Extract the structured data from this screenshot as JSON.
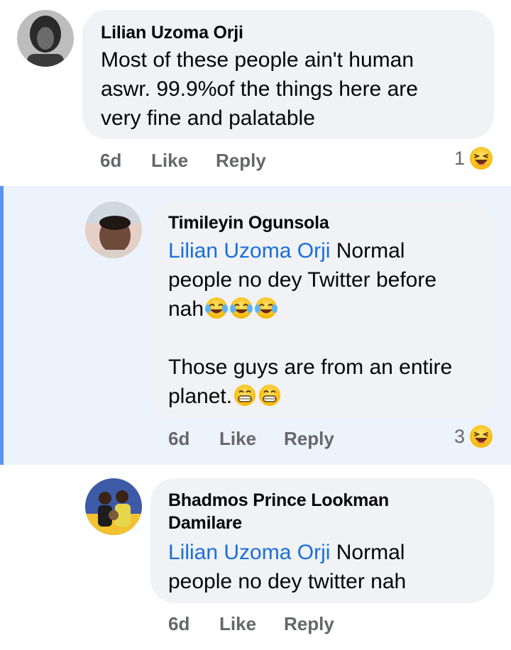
{
  "comments": [
    {
      "author": "Lilian Uzoma Orji",
      "lines": [
        "Most of these people ain't human",
        "aswr. 99.9%of the things here are",
        "very fine and palatable"
      ],
      "time": "6d",
      "like": "Like",
      "reply": "Reply",
      "reaction_count": "1",
      "reaction_icon": "haha-icon"
    },
    {
      "author": "Timileyin Ogunsola",
      "mention": "Lilian Uzoma Orji",
      "line1_rest": " Normal",
      "line2": "people no dey Twitter before",
      "line3": "nah",
      "line3_emoji": "joy-emoji x3",
      "line4": "Those guys are from an entire",
      "line5": "planet.",
      "line5_emoji": "grin-emoji x2",
      "time": "6d",
      "like": "Like",
      "reply": "Reply",
      "reaction_count": "3",
      "reaction_icon": "haha-icon",
      "highlight_color": "#edf3fc"
    },
    {
      "author_line1": "Bhadmos Prince Lookman",
      "author_line2": "Damilare",
      "mention": "Lilian Uzoma Orji",
      "line1_rest": " Normal",
      "line2": "people no dey twitter nah",
      "time": "6d",
      "like": "Like",
      "reply": "Reply"
    }
  ],
  "colors": {
    "mention": "#1a6ed8",
    "bubble": "#f0f2f5",
    "meta": "#65676b"
  }
}
